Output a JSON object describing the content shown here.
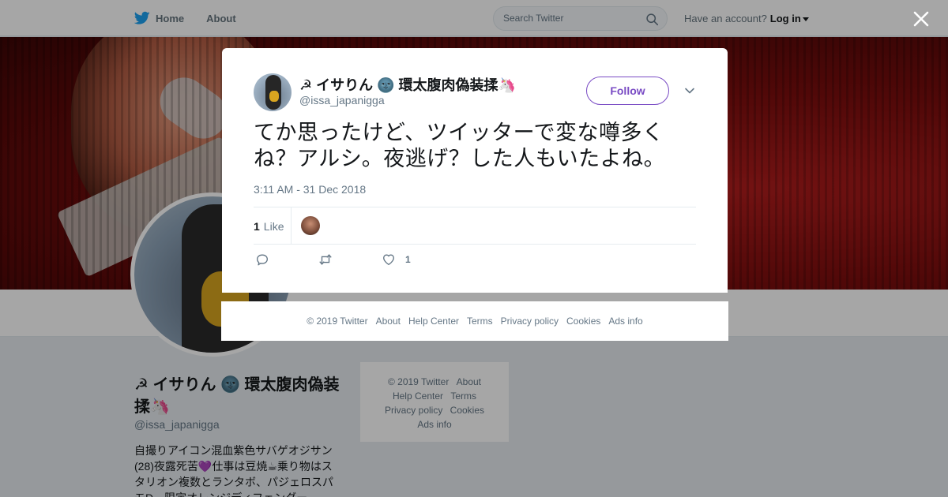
{
  "nav": {
    "home_label": "Home",
    "about_label": "About",
    "search_placeholder": "Search Twitter",
    "account_prompt": "Have an account?",
    "login_label": "Log in"
  },
  "profile": {
    "name": "☭ イサりん 🌚 環太腹肉偽装揉🦄",
    "handle": "@issa_japanigga",
    "bio": "自撮りアイコン混血紫色サバゲオジサン(28)夜露死苦💜仕事は豆焼☕乗り物はスタリオン複数とランタボ、パジェロスパモD　限定オレンジディフェンダー"
  },
  "side_footer": {
    "links": [
      "© 2019 Twitter",
      "About",
      "Help Center",
      "Terms",
      "Privacy policy",
      "Cookies",
      "Ads info"
    ]
  },
  "tweet": {
    "author_name": "☭ イサりん 🌚 環太腹肉偽装揉🦄",
    "author_handle": "@issa_japanigga",
    "follow_label": "Follow",
    "text": "てか思ったけど、ツイッターで変な噂多くね？アルシ。夜逃げ？した人もいたよね。",
    "timestamp": "3:11 AM - 31 Dec 2018",
    "likes_count": "1",
    "likes_label": "Like",
    "action_like_count": "1"
  },
  "modal_footer": {
    "links": [
      "© 2019 Twitter",
      "About",
      "Help Center",
      "Terms",
      "Privacy policy",
      "Cookies",
      "Ads info"
    ]
  },
  "icons": {
    "brand": "twitter-bird-icon",
    "search": "search-icon",
    "close": "close-icon",
    "chevron": "chevron-down-icon",
    "reply": "reply-icon",
    "retweet": "retweet-icon",
    "like": "heart-icon"
  },
  "colors": {
    "brand_blue": "#1da1f2",
    "follow_purple": "#794bc4",
    "muted_text": "#657786"
  }
}
